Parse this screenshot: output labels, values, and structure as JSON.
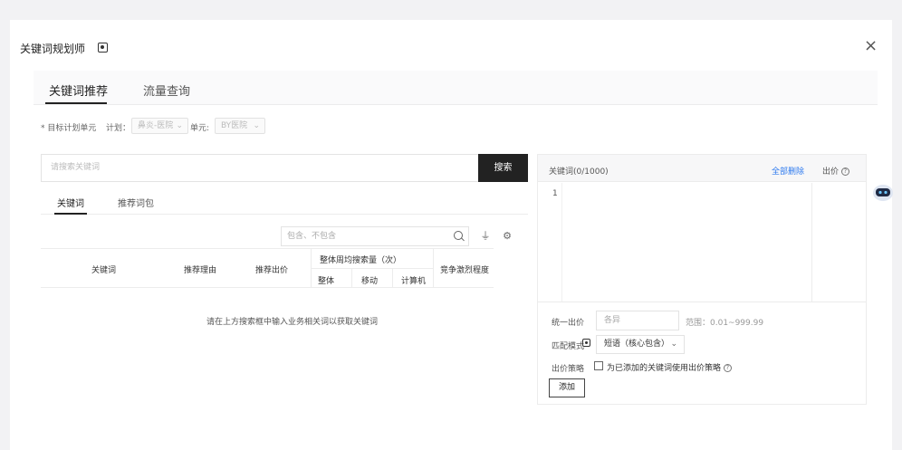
{
  "dialog": {
    "title": "关键词规划师",
    "close": "×"
  },
  "tabs": [
    {
      "label": "关键词推荐",
      "active": true
    },
    {
      "label": "流量查询",
      "active": false
    }
  ],
  "form": {
    "target_label": "* 目标计划单元",
    "plan_label": "计划：",
    "plan_value": "鼻炎-医院",
    "unit_label": "单元:",
    "unit_value": "BY医院"
  },
  "search": {
    "placeholder": "请搜索关键词",
    "button": "搜索"
  },
  "subtabs": [
    {
      "label": "关键词",
      "active": true
    },
    {
      "label": "推荐词包",
      "active": false
    }
  ],
  "filter": {
    "placeholder": "包含、不包含"
  },
  "table": {
    "headers": {
      "keyword": "关键词",
      "reason": "推荐理由",
      "bid": "推荐出价",
      "group": "整体周均搜索量（次）",
      "overall": "整体",
      "mobile": "移动",
      "pc": "计算机",
      "competition": "竞争激烈程度"
    },
    "empty_text": "请在上方搜索框中输入业务相关词以获取关键词"
  },
  "right_panel": {
    "keywords_header": "关键词(0/1000)",
    "delete_all": "全部删除",
    "bid_header": "出价",
    "help_glyph": "?",
    "first_line": "1",
    "uniform_bid_label": "统一出价",
    "uniform_bid_placeholder": "各异",
    "range_text": "范围：0.01~999.99",
    "match_label": "匹配模式",
    "match_value": "短语（核心包含）",
    "strategy_label": "出价策略",
    "strategy_checkbox_label": "为已添加的关键词使用出价策略",
    "add_button": "添加"
  },
  "colors": {
    "accent": "#222222",
    "link": "#2f7bef",
    "background": "#f2f2f4"
  }
}
